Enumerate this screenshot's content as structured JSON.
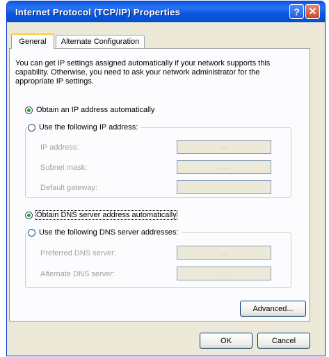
{
  "window": {
    "title": "Internet Protocol (TCP/IP) Properties"
  },
  "titlebar": {
    "help_glyph": "?",
    "close_glyph": "✕"
  },
  "tabs": [
    {
      "label": "General",
      "active": true
    },
    {
      "label": "Alternate Configuration",
      "active": false
    }
  ],
  "description": "You can get IP settings assigned automatically if your network supports this capability. Otherwise, you need to ask your network administrator for the appropriate IP settings.",
  "ip": {
    "auto_label": "Obtain an IP address automatically",
    "manual_label": "Use the following IP address:",
    "selected": "auto",
    "fields": [
      {
        "label": "IP address:",
        "value": ". . ."
      },
      {
        "label": "Subnet mask:",
        "value": ". . ."
      },
      {
        "label": "Default gateway:",
        "value": ". . ."
      }
    ]
  },
  "dns": {
    "auto_label": "Obtain DNS server address automatically",
    "manual_label": "Use the following DNS server addresses:",
    "selected": "auto",
    "fields": [
      {
        "label": "Preferred DNS server:",
        "value": ". . ."
      },
      {
        "label": "Alternate DNS server:",
        "value": ". . ."
      }
    ]
  },
  "buttons": {
    "advanced": "Advanced...",
    "ok": "OK",
    "cancel": "Cancel"
  },
  "colors": {
    "titlebar": "#0a56de",
    "dialog_bg": "#ece9d8",
    "radio_dot": "#21a121"
  }
}
